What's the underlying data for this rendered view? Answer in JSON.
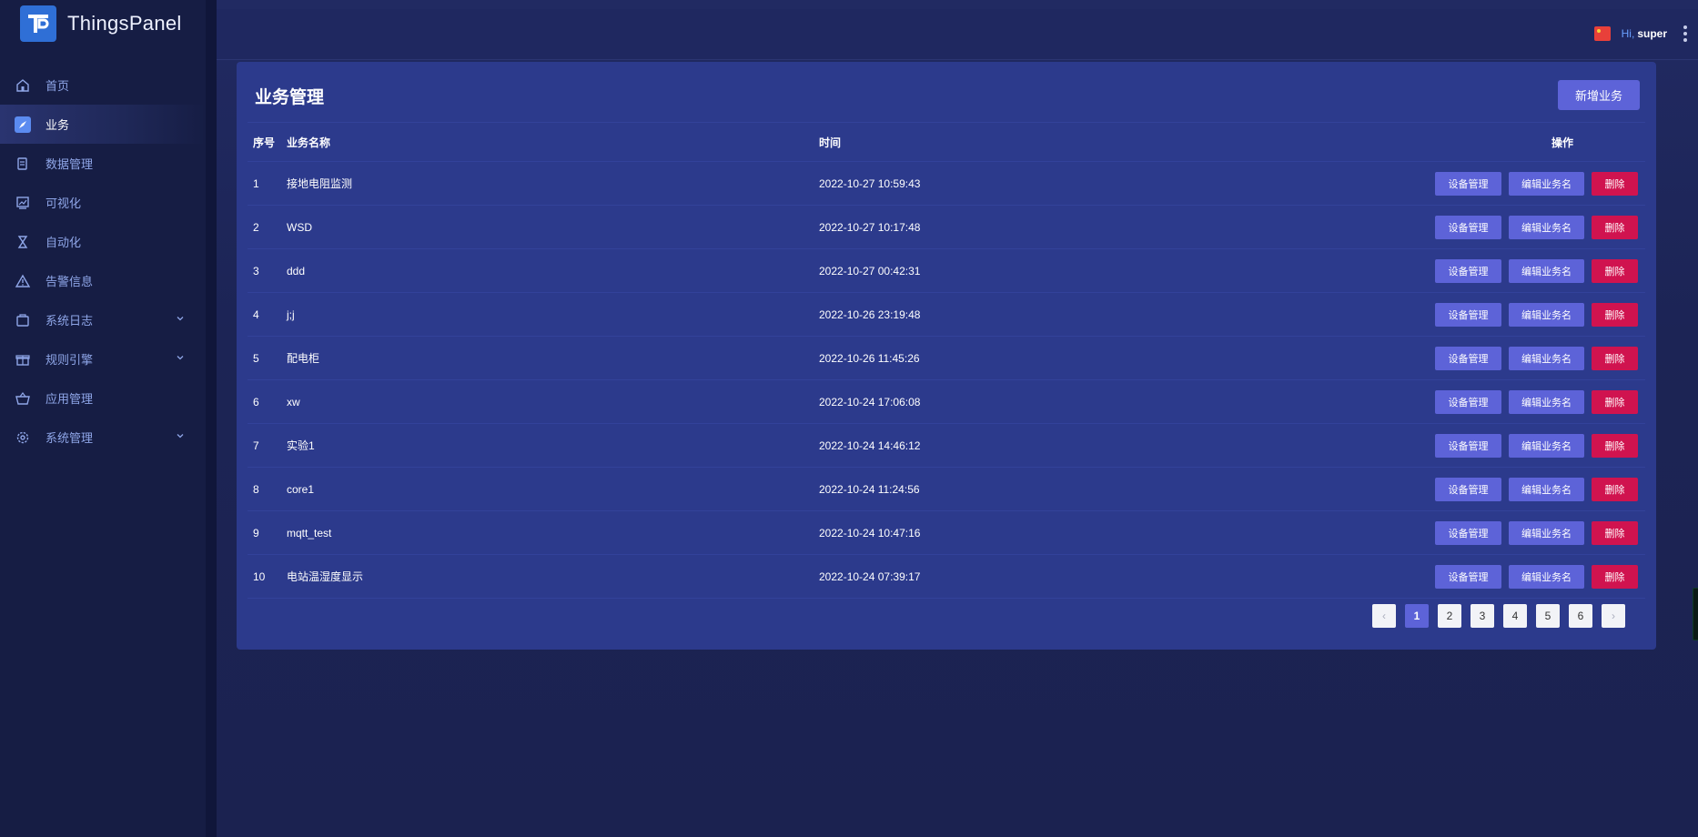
{
  "app": {
    "name": "ThingsPanel"
  },
  "sidebar": {
    "items": [
      {
        "label": "首页",
        "icon": "home-icon"
      },
      {
        "label": "业务",
        "icon": "compass-icon",
        "active": true
      },
      {
        "label": "数据管理",
        "icon": "data-icon"
      },
      {
        "label": "可视化",
        "icon": "chart-icon"
      },
      {
        "label": "自动化",
        "icon": "hourglass-icon"
      },
      {
        "label": "告警信息",
        "icon": "warning-icon"
      },
      {
        "label": "系统日志",
        "icon": "log-icon",
        "expandable": true
      },
      {
        "label": "规则引擎",
        "icon": "gift-icon",
        "expandable": true
      },
      {
        "label": "应用管理",
        "icon": "basket-icon"
      },
      {
        "label": "系统管理",
        "icon": "gear-icon",
        "expandable": true
      }
    ]
  },
  "header": {
    "greeting": "Hi,",
    "username": "super",
    "flag_icon": "china-flag-icon"
  },
  "page": {
    "title": "业务管理",
    "add_button": "新增业务"
  },
  "table": {
    "columns": {
      "idx": "序号",
      "name": "业务名称",
      "time": "时间",
      "ops": "操作"
    },
    "actions": {
      "device": "设备管理",
      "edit": "编辑业务名",
      "delete": "删除"
    },
    "rows": [
      {
        "idx": "1",
        "name": "接地电阻监测",
        "time": "2022-10-27 10:59:43"
      },
      {
        "idx": "2",
        "name": "WSD",
        "time": "2022-10-27 10:17:48"
      },
      {
        "idx": "3",
        "name": "ddd",
        "time": "2022-10-27 00:42:31"
      },
      {
        "idx": "4",
        "name": "j;j",
        "time": "2022-10-26 23:19:48"
      },
      {
        "idx": "5",
        "name": "配电柜",
        "time": "2022-10-26 11:45:26"
      },
      {
        "idx": "6",
        "name": "xw",
        "time": "2022-10-24 17:06:08"
      },
      {
        "idx": "7",
        "name": "实验1",
        "time": "2022-10-24 14:46:12"
      },
      {
        "idx": "8",
        "name": "core1",
        "time": "2022-10-24 11:24:56"
      },
      {
        "idx": "9",
        "name": "mqtt_test",
        "time": "2022-10-24 10:47:16"
      },
      {
        "idx": "10",
        "name": "电站温湿度显示",
        "time": "2022-10-24 07:39:17"
      }
    ]
  },
  "pagination": {
    "prev": "‹",
    "next": "›",
    "pages": [
      "1",
      "2",
      "3",
      "4",
      "5",
      "6"
    ],
    "current": "1"
  },
  "colors": {
    "accent": "#5d63d8",
    "danger": "#d0134f",
    "sidebar_bg": "#161d44",
    "card_bg": "#2c3a8c"
  }
}
